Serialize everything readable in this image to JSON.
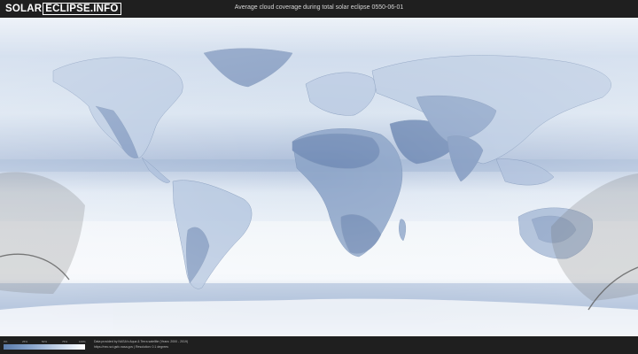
{
  "logo": {
    "part1": "SOLAR",
    "part2": "ECLIPSE.INFO"
  },
  "title": "Average cloud coverage during total solar eclipse 0550-06-01",
  "legend": {
    "ticks": [
      "0%",
      "25%",
      "50%",
      "75%",
      "100%"
    ],
    "colors": {
      "low": "#5b7cab",
      "mid": "#8ba6cc",
      "high": "#ffffff"
    }
  },
  "credits": {
    "line1": "Data provided by NASA's Aqua & Terra satellite (Years: 2000 - 2019)",
    "line2": "https://neo.sci.gsfc.nasa.gov | Resolution: 0.1 degrees"
  }
}
